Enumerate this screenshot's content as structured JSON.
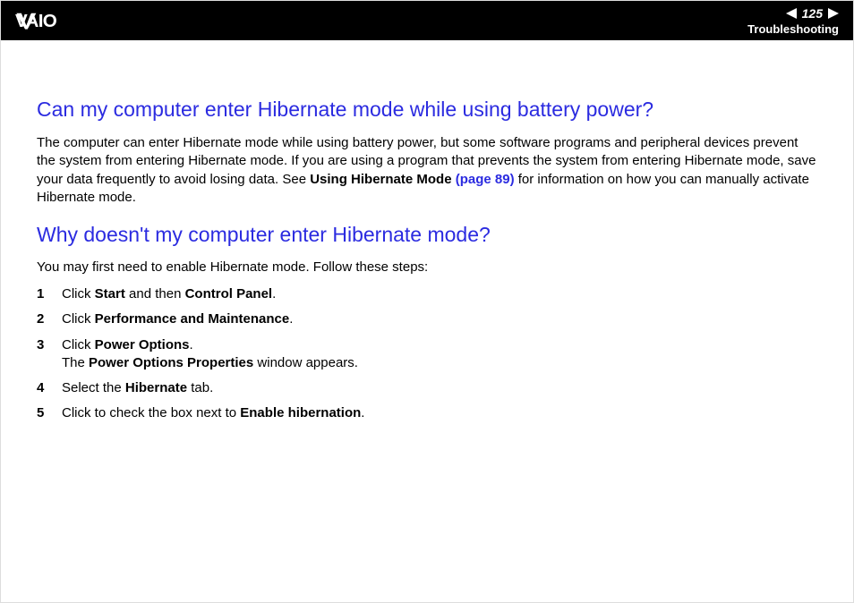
{
  "header": {
    "page_number": "125",
    "section": "Troubleshooting"
  },
  "section1": {
    "heading": "Can my computer enter Hibernate mode while using battery power?",
    "para_pre": "The computer can enter Hibernate mode while using battery power, but some software programs and peripheral devices prevent the system from entering Hibernate mode. If you are using a program that prevents the system from entering Hibernate mode, save your data frequently to avoid losing data. See ",
    "para_bold": "Using Hibernate Mode",
    "para_link": " (page 89)",
    "para_post": " for information on how you can manually activate Hibernate mode."
  },
  "section2": {
    "heading": "Why doesn't my computer enter Hibernate mode?",
    "intro": "You may first need to enable Hibernate mode. Follow these steps:",
    "steps": [
      {
        "pre": "Click ",
        "b1": "Start",
        "mid": " and then ",
        "b2": "Control Panel",
        "post": "."
      },
      {
        "pre": "Click ",
        "b1": "Performance and Maintenance",
        "post": "."
      },
      {
        "pre": "Click ",
        "b1": "Power Options",
        "post": ".",
        "line2_pre": "The ",
        "line2_b": "Power Options Properties",
        "line2_post": " window appears."
      },
      {
        "pre": "Select the ",
        "b1": "Hibernate",
        "post": " tab."
      },
      {
        "pre": "Click to check the box next to ",
        "b1": "Enable hibernation",
        "post": "."
      }
    ]
  }
}
